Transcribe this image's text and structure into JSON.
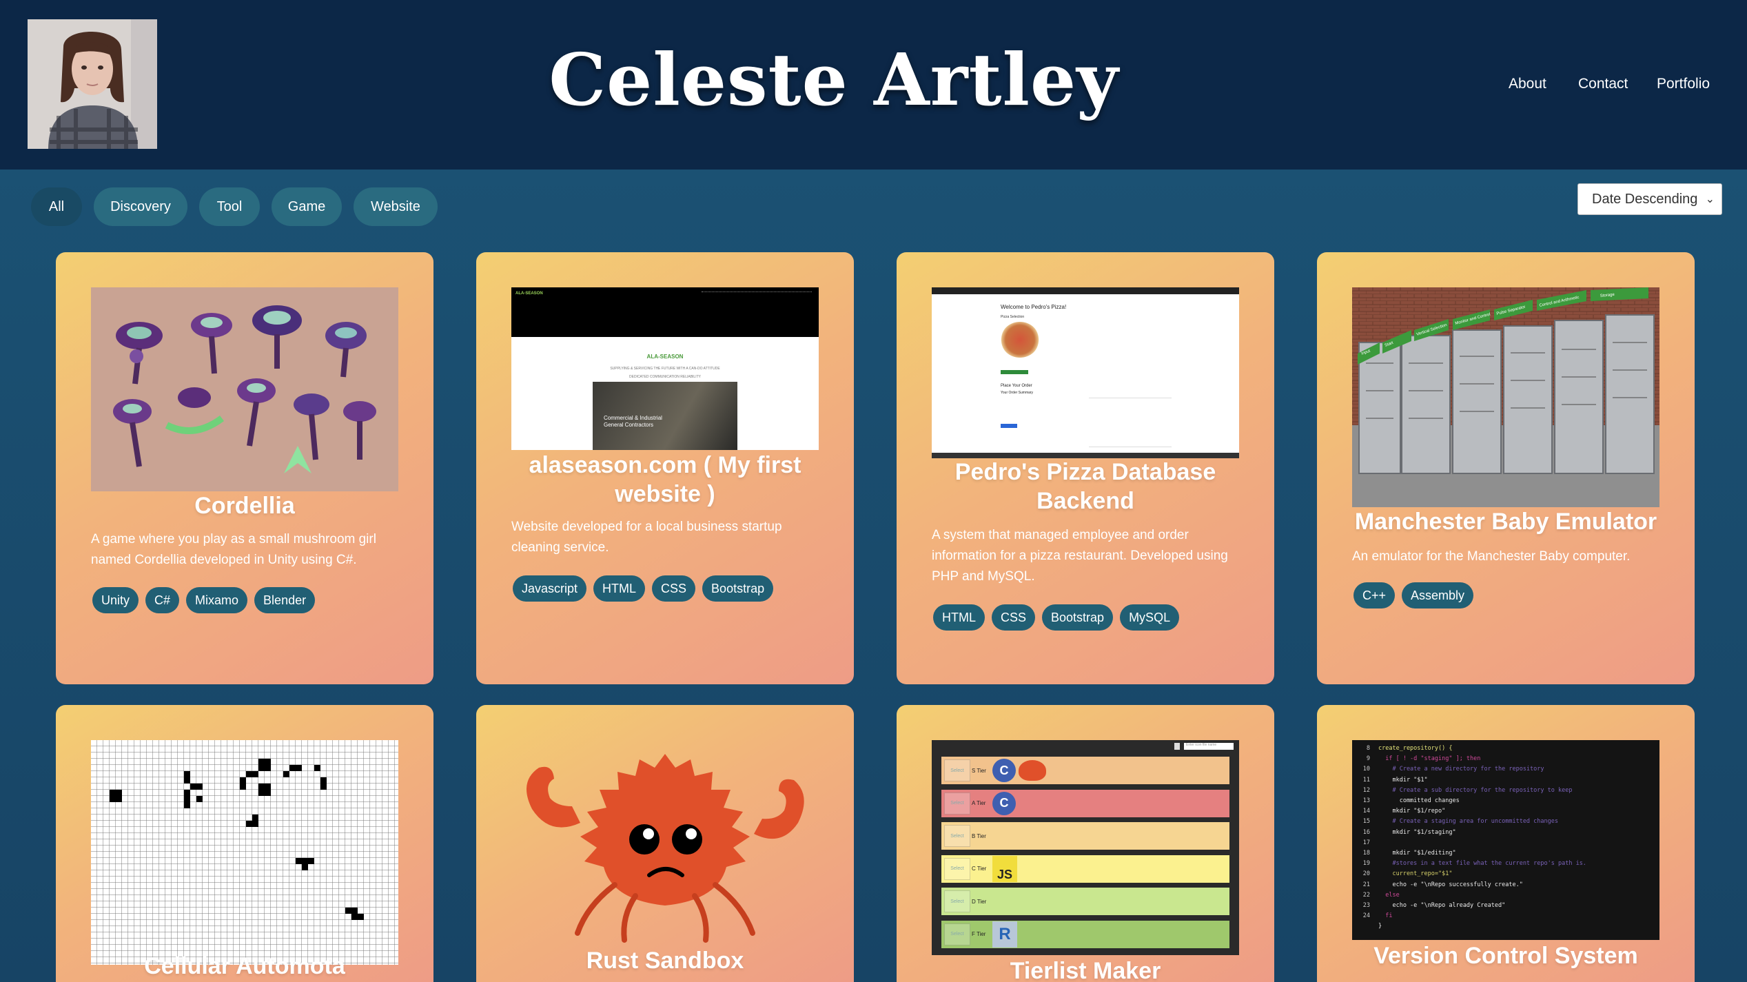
{
  "header": {
    "title": "Celeste Artley",
    "nav": [
      "About",
      "Contact",
      "Portfolio"
    ]
  },
  "filters": [
    "All",
    "Discovery",
    "Tool",
    "Game",
    "Website"
  ],
  "sort": {
    "selected": "Date Descending"
  },
  "cards": [
    {
      "title": "Cordellia",
      "description": "A game where you play as a small mushroom girl named Cordellia developed in Unity using C#.",
      "tags": [
        "Unity",
        "C#",
        "Mixamo",
        "Blender"
      ]
    },
    {
      "title": "alaseason.com ( My first website )",
      "description": "Website developed for a local business startup cleaning service.",
      "tags": [
        "Javascript",
        "HTML",
        "CSS",
        "Bootstrap"
      ],
      "thumb": {
        "brand": "ALA-SEASON",
        "tagline": "SUPPLYING & SERVICING THE FUTURE WITH A CAN-DO ATTITUDE",
        "subline": "DEDICATED COMMUNICATION RELIABILITY",
        "photo_caption": "Commercial & Industrial General Contractors"
      }
    },
    {
      "title": "Pedro's Pizza Database Backend",
      "description": "A system that managed employee and order information for a pizza restaurant. Developed using PHP and MySQL.",
      "tags": [
        "HTML",
        "CSS",
        "Bootstrap",
        "MySQL"
      ],
      "thumb": {
        "brand": "Pedro's Pizza",
        "welcome": "Welcome to Pedro's Pizza!",
        "section1": "Pizza Selection",
        "section2": "Place Your Order",
        "section3": "Your Order Summary"
      }
    },
    {
      "title": "Manchester Baby Emulator",
      "description": "An emulator for the Manchester Baby computer.",
      "tags": [
        "C++",
        "Assembly"
      ],
      "thumb": {
        "signs": [
          "Storage",
          "Control and Arithmetic",
          "Pulse Separator",
          "Monitor and Control",
          "Vertical Selection",
          "Start",
          "Input"
        ]
      }
    },
    {
      "title": "Cellular Automota"
    },
    {
      "title": "Rust Sandbox"
    },
    {
      "title": "Tierlist Maker",
      "thumb": {
        "search_placeholder": "Enter icon file name",
        "select_label": "Select",
        "tiers": [
          "S Tier",
          "A Tier",
          "B Tier",
          "C Tier",
          "D Tier",
          "F Tier"
        ],
        "icons": [
          "C",
          "C",
          "JS",
          "R"
        ]
      }
    },
    {
      "title": "Version Control System",
      "thumb": {
        "line_numbers": [
          "8",
          "9",
          "10",
          "11",
          "12",
          "13",
          "14",
          "15",
          "16",
          "17",
          "18",
          "19",
          "20",
          "21",
          "22",
          "23",
          "24"
        ],
        "code": [
          "create_repository() {",
          "  if [ ! -d \"staging\" ]; then",
          "    # Create a new directory for the repository",
          "    mkdir \"$1\"",
          "    # Create a sub directory for the repository to keep",
          "      committed changes",
          "    mkdir \"$1/repo\"",
          "    # Create a staging area for uncommitted changes",
          "    mkdir \"$1/staging\"",
          "",
          "    mkdir \"$1/editing\"",
          "    #stores in a text file what the current repo's path is.",
          "    current_repo=\"$1\"",
          "    echo -e \"\\nRepo successfully create.\"",
          "  else",
          "    echo -e \"\\nRepo already Created\"",
          "  fi",
          "}"
        ]
      }
    }
  ]
}
